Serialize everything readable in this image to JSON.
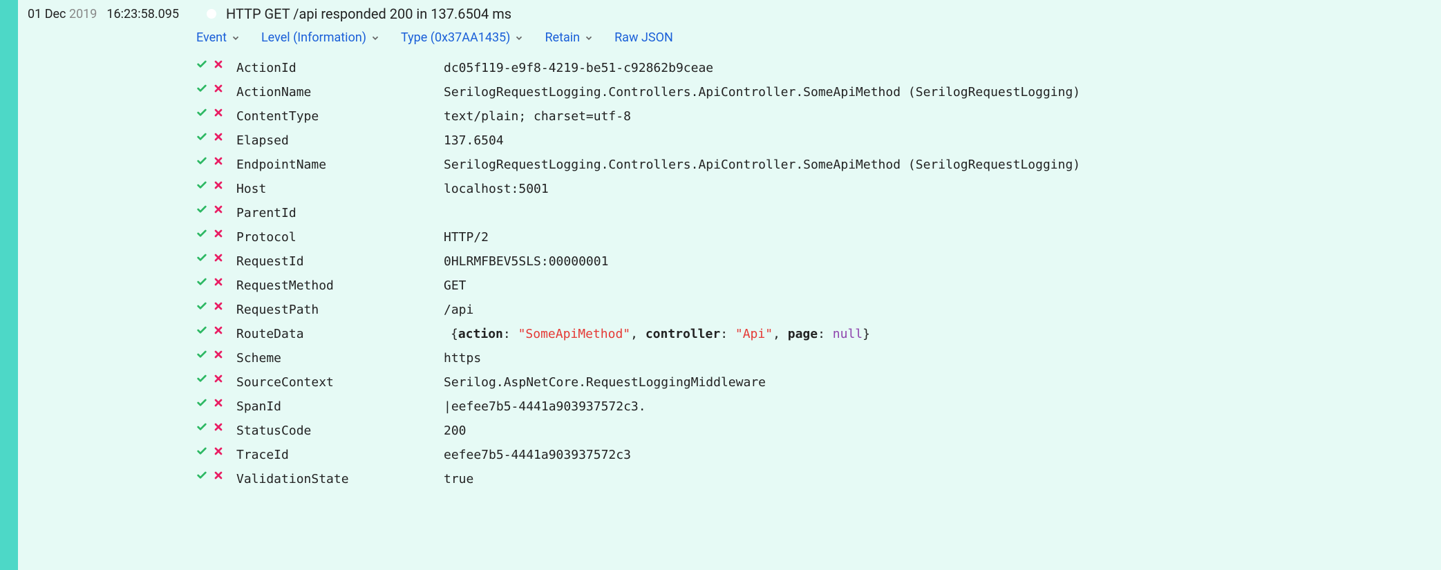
{
  "timestamp": {
    "day_month": "01 Dec ",
    "year": "2019",
    "time": "16:23:58.095"
  },
  "message": "HTTP GET /api responded 200 in 137.6504 ms",
  "toolbar": {
    "event": "Event",
    "level": "Level (Information)",
    "type": "Type (0x37AA1435)",
    "retain": "Retain",
    "raw_json": "Raw JSON"
  },
  "route_data": {
    "action_key": "action",
    "action_val": "\"SomeApiMethod\"",
    "controller_key": "controller",
    "controller_val": "\"Api\"",
    "page_key": "page",
    "page_val": "null"
  },
  "properties": [
    {
      "key": "ActionId",
      "value": "dc05f119-e9f8-4219-be51-c92862b9ceae",
      "type": "plain"
    },
    {
      "key": "ActionName",
      "value": "SerilogRequestLogging.Controllers.ApiController.SomeApiMethod (SerilogRequestLogging)",
      "type": "plain"
    },
    {
      "key": "ContentType",
      "value": "text/plain; charset=utf-8",
      "type": "plain"
    },
    {
      "key": "Elapsed",
      "value": "137.6504",
      "type": "plain"
    },
    {
      "key": "EndpointName",
      "value": "SerilogRequestLogging.Controllers.ApiController.SomeApiMethod (SerilogRequestLogging)",
      "type": "plain"
    },
    {
      "key": "Host",
      "value": "localhost:5001",
      "type": "plain"
    },
    {
      "key": "ParentId",
      "value": "",
      "type": "plain"
    },
    {
      "key": "Protocol",
      "value": "HTTP/2",
      "type": "plain"
    },
    {
      "key": "RequestId",
      "value": "0HLRMFBEV5SLS:00000001",
      "type": "plain"
    },
    {
      "key": "RequestMethod",
      "value": "GET",
      "type": "plain"
    },
    {
      "key": "RequestPath",
      "value": "/api",
      "type": "plain"
    },
    {
      "key": "RouteData",
      "value": "",
      "type": "route"
    },
    {
      "key": "Scheme",
      "value": "https",
      "type": "plain"
    },
    {
      "key": "SourceContext",
      "value": "Serilog.AspNetCore.RequestLoggingMiddleware",
      "type": "plain"
    },
    {
      "key": "SpanId",
      "value": "|eefee7b5-4441a903937572c3.",
      "type": "plain"
    },
    {
      "key": "StatusCode",
      "value": "200",
      "type": "plain"
    },
    {
      "key": "TraceId",
      "value": "eefee7b5-4441a903937572c3",
      "type": "plain"
    },
    {
      "key": "ValidationState",
      "value": "true",
      "type": "plain"
    }
  ]
}
